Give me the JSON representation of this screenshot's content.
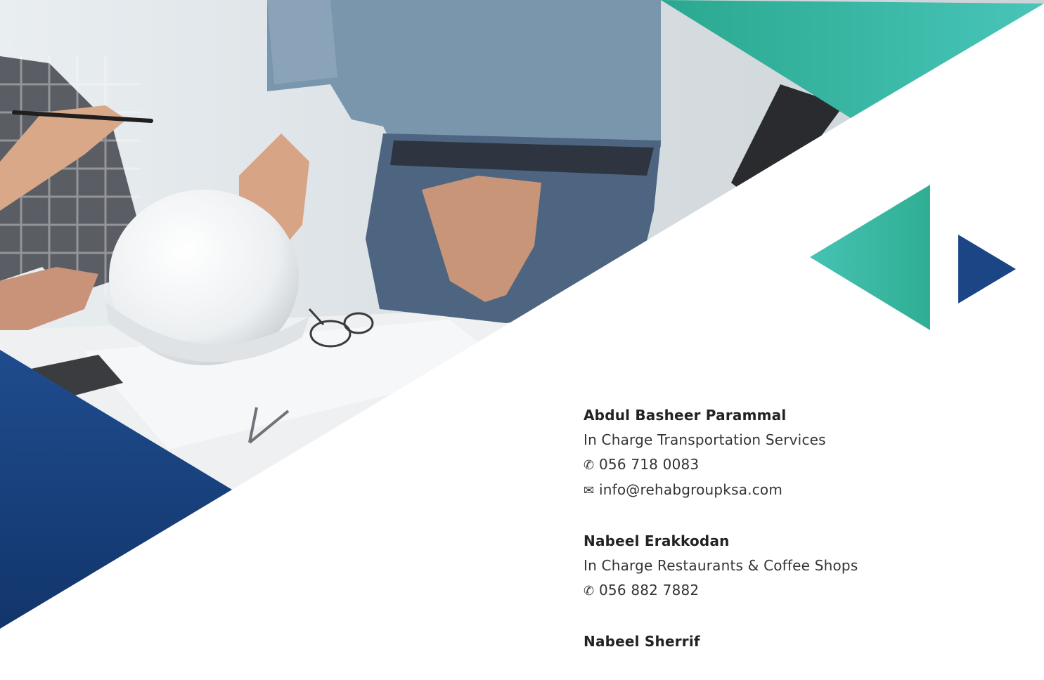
{
  "colors": {
    "teal": "#2fb39b",
    "teal_light": "#45c4b4",
    "navy": "#1c4586",
    "navy_dark": "#123468"
  },
  "contacts": [
    {
      "name": "Abdul Basheer Parammal",
      "role": "In Charge Transportation Services",
      "phone": "056 718 0083",
      "email": "info@rehabgroupksa.com"
    },
    {
      "name": "Nabeel Erakkodan",
      "role": "In Charge Restaurants & Coffee Shops",
      "phone": "056 882 7882"
    },
    {
      "name": "Nabeel Sherrif"
    }
  ],
  "icons": {
    "phone": "phone-icon",
    "email": "mail-icon"
  }
}
